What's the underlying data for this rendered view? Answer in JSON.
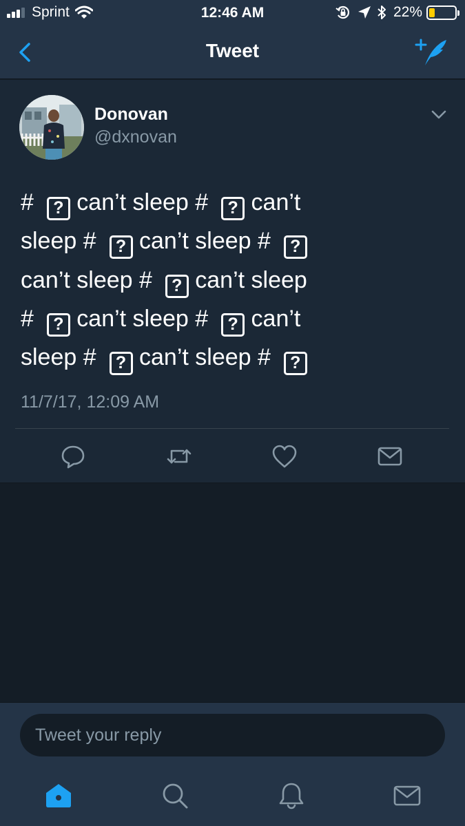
{
  "status_bar": {
    "carrier": "Sprint",
    "time": "12:46 AM",
    "battery": "22%",
    "battery_level": 0.22
  },
  "nav": {
    "title": "Tweet",
    "back_icon": "chevron-left-icon",
    "compose_icon": "compose-tweet-icon"
  },
  "tweet": {
    "author_name": "Donovan",
    "author_handle": "@dxnovan",
    "lines": [
      [
        "#",
        "?",
        "can’t sleep #",
        "?",
        "can’t"
      ],
      [
        "sleep #",
        "?",
        "can’t sleep #",
        "?"
      ],
      [
        "can’t sleep #",
        "?",
        "can’t sleep"
      ],
      [
        "#",
        "?",
        "can’t sleep #",
        "?",
        "can’t"
      ],
      [
        "sleep #",
        "?",
        "can’t sleep #",
        "?"
      ]
    ],
    "date": "11/7/17, 12:09 AM",
    "actions": [
      "reply-icon",
      "retweet-icon",
      "like-icon",
      "direct-message-icon"
    ]
  },
  "reply": {
    "placeholder": "Tweet your reply"
  },
  "tabs": [
    "home-icon",
    "search-icon",
    "notifications-icon",
    "messages-icon"
  ],
  "colors": {
    "accent": "#1da1f2",
    "background": "#141d26",
    "card": "#1b2836",
    "bar": "#243447",
    "secondary_text": "#8899a6"
  }
}
